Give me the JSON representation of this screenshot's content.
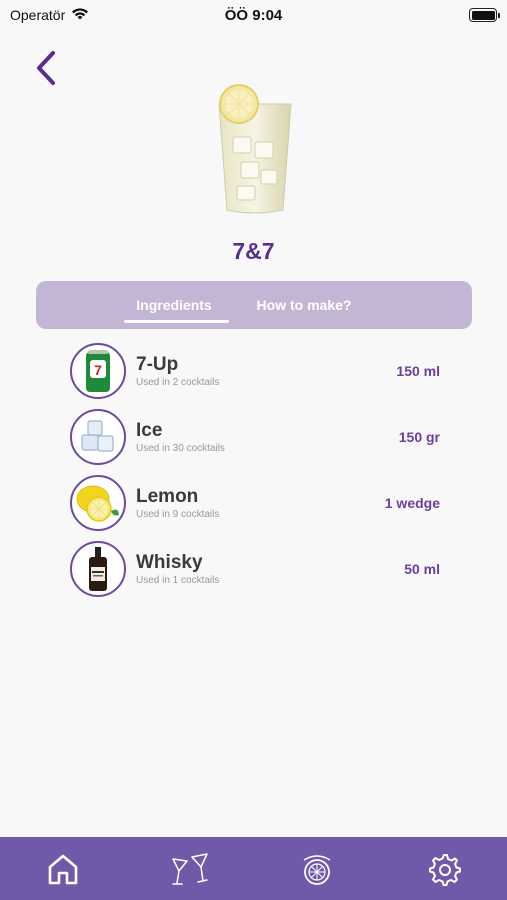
{
  "status_bar": {
    "carrier": "Operatör",
    "time": "ÖÖ 9:04",
    "icons": [
      "wifi-icon",
      "battery-icon"
    ]
  },
  "header": {
    "back_icon": "chevron-left-icon",
    "drink_name": "7&7"
  },
  "tabs": [
    {
      "label": "Ingredients",
      "active": true
    },
    {
      "label": "How to make?",
      "active": false
    }
  ],
  "ingredients": [
    {
      "name": "7-Up",
      "used": "Used in 2 cocktails",
      "amount": "150 ml",
      "icon": "soda-can-icon"
    },
    {
      "name": "Ice",
      "used": "Used in 30 cocktails",
      "amount": "150 gr",
      "icon": "ice-cubes-icon"
    },
    {
      "name": "Lemon",
      "used": "Used in 9 cocktails",
      "amount": "1 wedge",
      "icon": "lemon-icon"
    },
    {
      "name": "Whisky",
      "used": "Used in 1 cocktails",
      "amount": "50 ml",
      "icon": "whisky-bottle-icon"
    }
  ],
  "bottom_nav": [
    {
      "icon": "home-icon"
    },
    {
      "icon": "cocktail-glasses-icon"
    },
    {
      "icon": "lemon-shaker-icon"
    },
    {
      "icon": "gear-icon"
    }
  ],
  "colors": {
    "accent": "#5a2e91",
    "tab_bg": "#c3b6d4",
    "nav_bg": "#7059a8",
    "amount": "#6b3fa0"
  }
}
